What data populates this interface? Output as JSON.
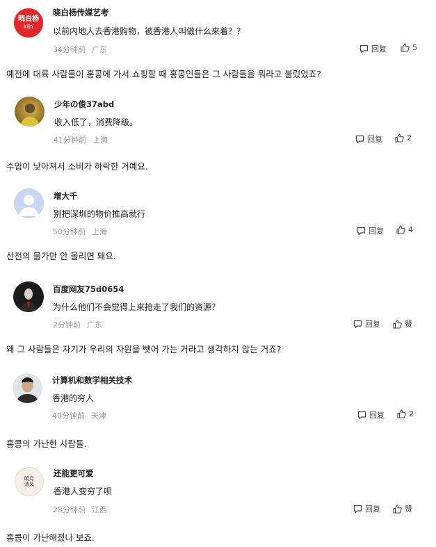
{
  "labels": {
    "reply": "回复"
  },
  "comments": [
    {
      "user": "晓白杨传媒艺考",
      "avatar_text": "晓白杨",
      "avatar_subtext": "XBY",
      "text": "以前内地人去香港购物，被香港人叫做什么来着？？",
      "time": "34分钟前",
      "location": "广东",
      "likes": "5",
      "translation": "예전에 대륙 사람들이 홍콩에 가서 쇼핑할 때 홍콩인들은 그 사람들을 뭐라고 불렀었죠?"
    },
    {
      "user": "少年の俊37abd",
      "text": "收入低了，消费降级。",
      "time": "41分钟前",
      "location": "上海",
      "likes": "2",
      "translation": "수입이 낮아져서 소비가 하락한 거예요."
    },
    {
      "user": "增大千",
      "text": "别把深圳的物价推高就行",
      "time": "50分钟前",
      "location": "上海",
      "likes": "4",
      "translation": "선전의 물가만 안 올리면 돼요."
    },
    {
      "user": "百度网友75d0654",
      "text": "为什么他们不会觉得上来抢走了我们的资源？",
      "time": "2分钟前",
      "location": "广东",
      "likes": "赞",
      "translation": "왜 그 사람들은 자기가 우리의 자원을 뺏어 가는 거라고 생각하지 않는 거죠?"
    },
    {
      "user": "计算机和数学相关技术",
      "text": "香港的穷人",
      "time": "40分钟前",
      "location": "天津",
      "likes": "2",
      "translation": "홍콩의 가난한 사람들."
    },
    {
      "user": "还能更可爱",
      "avatar_text": "明月清风",
      "text": "香港人变穷了呗",
      "time": "28分钟前",
      "location": "江西",
      "likes": "赞",
      "translation": "홍콩이 가난해졌나 보죠."
    }
  ]
}
